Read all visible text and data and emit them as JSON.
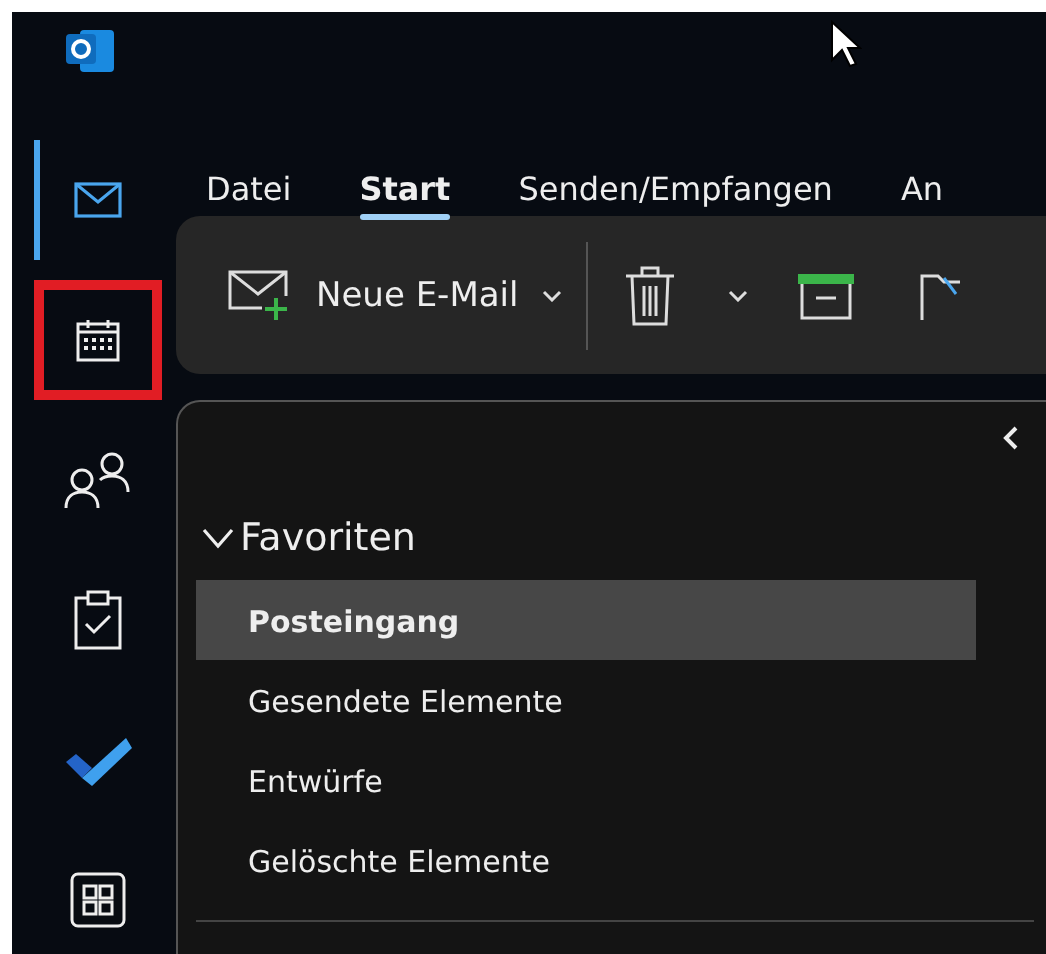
{
  "rail": {
    "items": [
      {
        "kind": "mail",
        "selected": true,
        "highlighted": false
      },
      {
        "kind": "calendar",
        "selected": false,
        "highlighted": true
      },
      {
        "kind": "people",
        "selected": false,
        "highlighted": false
      },
      {
        "kind": "tasks",
        "selected": false,
        "highlighted": false
      },
      {
        "kind": "todo",
        "selected": false,
        "highlighted": false
      },
      {
        "kind": "apps",
        "selected": false,
        "highlighted": false
      }
    ]
  },
  "ribbon": {
    "tabs": [
      {
        "label": "Datei",
        "selected": false
      },
      {
        "label": "Start",
        "selected": true
      },
      {
        "label": "Senden/Empfangen",
        "selected": false
      },
      {
        "label": "An",
        "selected": false
      }
    ],
    "toolbar": {
      "new_mail": "Neue E-Mail"
    }
  },
  "folder_pane": {
    "section": {
      "label": "Favoriten",
      "expanded": true,
      "items": [
        {
          "label": "Posteingang",
          "selected": true
        },
        {
          "label": "Gesendete Elemente",
          "selected": false
        },
        {
          "label": "Entwürfe",
          "selected": false
        },
        {
          "label": "Gelöschte Elemente",
          "selected": false
        }
      ]
    }
  }
}
